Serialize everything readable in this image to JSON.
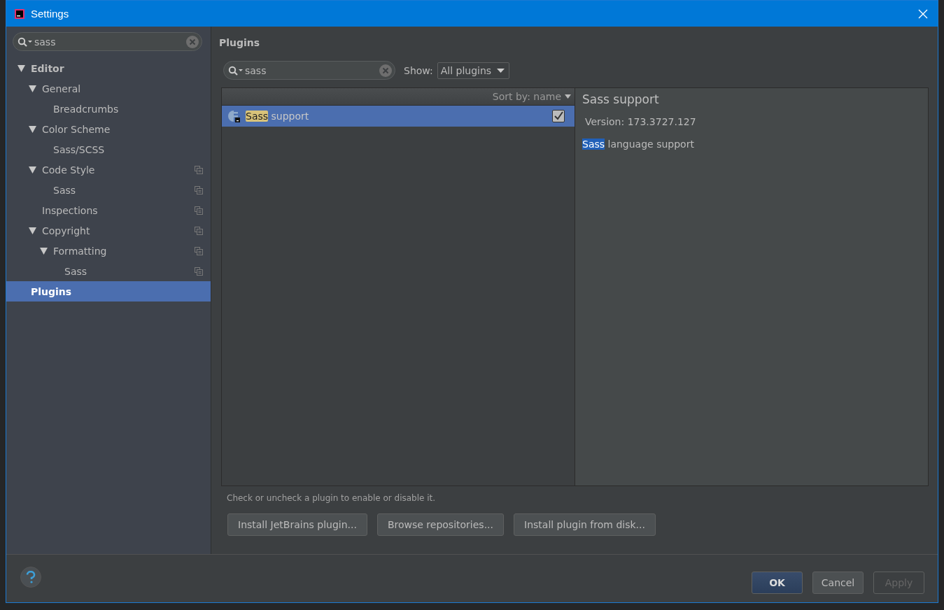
{
  "window": {
    "title": "Settings"
  },
  "sidebar": {
    "search": {
      "value": "sass"
    },
    "tree": [
      {
        "label": "Editor",
        "bold": true,
        "expanded": true,
        "selected": false,
        "project_scoped": false,
        "children": [
          {
            "label": "General",
            "bold": false,
            "expanded": true,
            "selected": false,
            "project_scoped": false,
            "children": [
              {
                "label": "Breadcrumbs",
                "bold": false,
                "selected": false,
                "project_scoped": false
              }
            ]
          },
          {
            "label": "Color Scheme",
            "bold": false,
            "expanded": true,
            "selected": false,
            "project_scoped": false,
            "children": [
              {
                "label": "Sass/SCSS",
                "bold": false,
                "selected": false,
                "project_scoped": false
              }
            ]
          },
          {
            "label": "Code Style",
            "bold": false,
            "expanded": true,
            "selected": false,
            "project_scoped": true,
            "children": [
              {
                "label": "Sass",
                "bold": false,
                "selected": false,
                "project_scoped": true
              }
            ]
          },
          {
            "label": "Inspections",
            "bold": false,
            "selected": false,
            "project_scoped": true
          },
          {
            "label": "Copyright",
            "bold": false,
            "expanded": true,
            "selected": false,
            "project_scoped": true,
            "children": [
              {
                "label": "Formatting",
                "bold": false,
                "expanded": true,
                "selected": false,
                "project_scoped": true,
                "children": [
                  {
                    "label": "Sass",
                    "bold": false,
                    "selected": false,
                    "project_scoped": true
                  }
                ]
              }
            ]
          }
        ]
      },
      {
        "label": "Plugins",
        "bold": true,
        "selected": true,
        "project_scoped": false
      }
    ]
  },
  "main": {
    "title": "Plugins",
    "search": {
      "value": "sass"
    },
    "show_label": "Show:",
    "show_value": "All plugins",
    "sort_label": "Sort by: name",
    "plugins": [
      {
        "name_match": "Sass",
        "name_rest": " support",
        "checked": true,
        "selected": true
      }
    ],
    "details": {
      "title": "Sass support",
      "version": "Version: 173.3727.127",
      "description_match": "Sass",
      "description_rest": " language support"
    },
    "hint": "Check or uncheck a plugin to enable or disable it.",
    "actions": [
      "Install JetBrains plugin...",
      "Browse repositories...",
      "Install plugin from disk..."
    ]
  },
  "footer": {
    "buttons": [
      {
        "label": "OK",
        "kind": "default",
        "disabled": false
      },
      {
        "label": "Cancel",
        "kind": "normal",
        "disabled": false
      },
      {
        "label": "Apply",
        "kind": "normal",
        "disabled": true
      }
    ]
  }
}
